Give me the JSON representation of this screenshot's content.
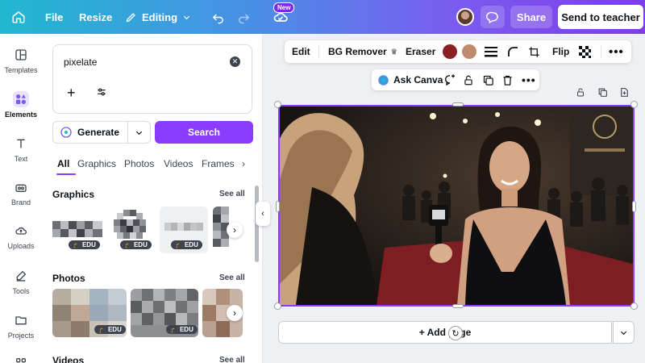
{
  "topbar": {
    "file": "File",
    "resize": "Resize",
    "editing": "Editing",
    "new_badge": "New",
    "share": "Share",
    "send_to_teacher": "Send to teacher"
  },
  "rail": {
    "items": [
      {
        "label": "Templates",
        "icon": "templates-icon"
      },
      {
        "label": "Elements",
        "icon": "elements-icon",
        "active": true
      },
      {
        "label": "Text",
        "icon": "text-icon"
      },
      {
        "label": "Brand",
        "icon": "brand-icon"
      },
      {
        "label": "Uploads",
        "icon": "uploads-icon"
      },
      {
        "label": "Tools",
        "icon": "tools-icon"
      },
      {
        "label": "Projects",
        "icon": "projects-icon"
      },
      {
        "label": "",
        "icon": "apps-icon"
      }
    ]
  },
  "panel": {
    "search_value": "pixelate",
    "generate": "Generate",
    "search": "Search",
    "tabs": [
      "All",
      "Graphics",
      "Photos",
      "Videos",
      "Frames"
    ],
    "graphics_title": "Graphics",
    "photos_title": "Photos",
    "videos_title": "Videos",
    "see_all": "See all",
    "edu_badge": "EDU"
  },
  "context_toolbar": {
    "edit": "Edit",
    "bg_remover": "BG Remover",
    "eraser": "Eraser",
    "flip": "Flip",
    "swatch_1": "#8a1f1f",
    "swatch_2": "#c08a6c"
  },
  "ask_canva": {
    "label": "Ask Canva"
  },
  "canvas": {
    "add_page": "+ Add page"
  },
  "colors": {
    "accent": "#8b3dff"
  }
}
